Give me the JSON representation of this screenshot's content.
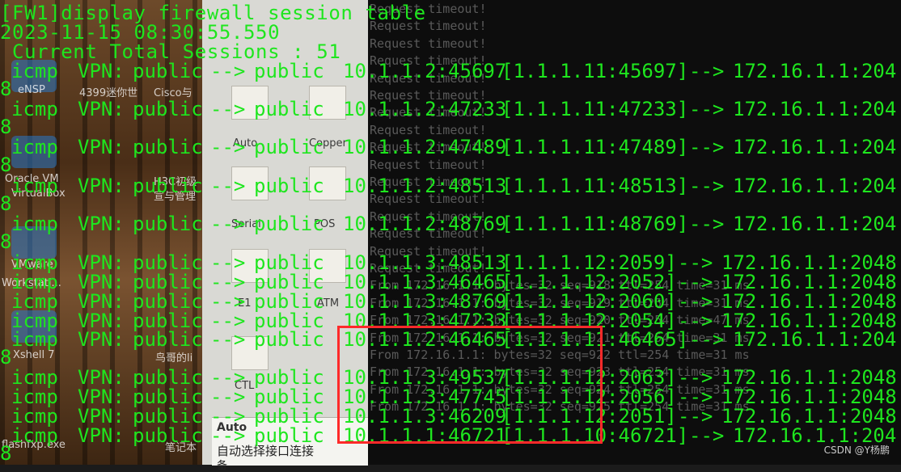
{
  "console": {
    "command": "[FW1]display firewall session table",
    "timestamp": "2023-11-15 08:30:55.550",
    "total": " Current Total Sessions : 51"
  },
  "sessions": [
    {
      "proto": "icmp",
      "vpn": "VPN:",
      "zone": "public",
      "arrow": "-->",
      "to": "public",
      "src": "10.1.1.2:45697",
      "nat": "[1.1.1.11:45697]",
      "arr2": "-->",
      "dst": "172.16.1.1:204",
      "wrap": "8"
    },
    {
      "proto": "icmp",
      "vpn": "VPN:",
      "zone": "public",
      "arrow": "-->",
      "to": "public",
      "src": "10.1.1.2:47233",
      "nat": "[1.1.1.11:47233]",
      "arr2": "-->",
      "dst": "172.16.1.1:204",
      "wrap": "8"
    },
    {
      "proto": "icmp",
      "vpn": "VPN:",
      "zone": "public",
      "arrow": "-->",
      "to": "public",
      "src": "10.1.1.2:47489",
      "nat": "[1.1.1.11:47489]",
      "arr2": "-->",
      "dst": "172.16.1.1:204",
      "wrap": "8"
    },
    {
      "proto": "icmp",
      "vpn": "VPN:",
      "zone": "public",
      "arrow": "-->",
      "to": "public",
      "src": "10.1.1.2:48513",
      "nat": "[1.1.1.11:48513]",
      "arr2": "-->",
      "dst": "172.16.1.1:204",
      "wrap": "8"
    },
    {
      "proto": "icmp",
      "vpn": "VPN:",
      "zone": "public",
      "arrow": "-->",
      "to": "public",
      "src": "10.1.1.2:48769",
      "nat": "[1.1.1.11:48769]",
      "arr2": "-->",
      "dst": "172.16.1.1:204",
      "wrap": "8"
    },
    {
      "proto": "icmp",
      "vpn": "VPN:",
      "zone": "public",
      "arrow": "-->",
      "to": "public",
      "src": "10.1.1.3:48513",
      "nat": "[1.1.1.12:2059]",
      "arr2": "-->",
      "dst": "172.16.1.1:2048",
      "wrap": ""
    },
    {
      "proto": "icmp",
      "vpn": "VPN:",
      "zone": "public",
      "arrow": "-->",
      "to": "public",
      "src": "10.1.1.3:46465",
      "nat": "[1.1.1.12:2052]",
      "arr2": "-->",
      "dst": "172.16.1.1:2048",
      "wrap": ""
    },
    {
      "proto": "icmp",
      "vpn": "VPN:",
      "zone": "public",
      "arrow": "-->",
      "to": "public",
      "src": "10.1.1.3:48769",
      "nat": "[1.1.1.12:2060]",
      "arr2": "-->",
      "dst": "172.16.1.1:2048",
      "wrap": ""
    },
    {
      "proto": "icmp",
      "vpn": "VPN:",
      "zone": "public",
      "arrow": "-->",
      "to": "public",
      "src": "10.1.1.3:47233",
      "nat": "[1.1.1.12:2054]",
      "arr2": "-->",
      "dst": "172.16.1.1:2048",
      "wrap": ""
    },
    {
      "proto": "icmp",
      "vpn": "VPN:",
      "zone": "public",
      "arrow": "-->",
      "to": "public",
      "src": "10.1.1.2:46465",
      "nat": "[1.1.1.11:46465]",
      "arr2": "-->",
      "dst": "172.16.1.1:204",
      "wrap": "8"
    },
    {
      "proto": "icmp",
      "vpn": "VPN:",
      "zone": "public",
      "arrow": "-->",
      "to": "public",
      "src": "10.1.1.3:49537",
      "nat": "[1.1.1.12:2063]",
      "arr2": "-->",
      "dst": "172.16.1.1:2048",
      "wrap": ""
    },
    {
      "proto": "icmp",
      "vpn": "VPN:",
      "zone": "public",
      "arrow": "-->",
      "to": "public",
      "src": "10.1.1.3:47745",
      "nat": "[1.1.1.12:2056]",
      "arr2": "-->",
      "dst": "172.16.1.1:2048",
      "wrap": ""
    },
    {
      "proto": "icmp",
      "vpn": "VPN:",
      "zone": "public",
      "arrow": "-->",
      "to": "public",
      "src": "10.1.1.3:46209",
      "nat": "[1.1.1.12:2051]",
      "arr2": "-->",
      "dst": "172.16.1.1:2048",
      "wrap": ""
    },
    {
      "proto": "icmp",
      "vpn": "VPN:",
      "zone": "public",
      "arrow": "-->",
      "to": "public",
      "src": "10.1.1.1:46721",
      "nat": "[1.1.1.10:46721]",
      "arr2": "-->",
      "dst": "172.16.1.1:204",
      "wrap": "8"
    }
  ],
  "ping_window": {
    "lines": [
      "Request timeout!",
      "Request timeout!",
      "Request timeout!",
      "Request timeout!",
      "Request timeout!",
      "Request timeout!",
      "Request timeout!",
      "Request timeout!",
      "Request timeout!",
      "Request timeout!",
      "Request timeout!",
      "Request timeout!",
      "Request timeout!",
      "Request timeout!",
      "Request timeout!",
      "Request timeout!",
      "From 172.16.1.1: bytes=32 seq=918 ttl=254 time=31 ms",
      "From 172.16.1.1: bytes=32 seq=919 ttl=254 time=31 ms",
      "From 172.16.1.1: bytes=32 seq=920 ttl=254 time=47 ms",
      "From 172.16.1.1: bytes=32 seq=921 ttl=254 time=31 ms",
      "From 172.16.1.1: bytes=32 seq=922 ttl=254 time=31 ms",
      "From 172.16.1.1: bytes=32 seq=923 ttl=254 time=31 ms",
      "From 172.16.1.1: bytes=32 seq=924 ttl=254 time=31 ms",
      "From 172.16.1.1: bytes=32 seq=925 ttl=254 time=31 ms"
    ]
  },
  "desktop": {
    "icons": [
      "eNSP",
      "4399迷你世",
      "Cisco与",
      "Oracle VM",
      "VirtualBox",
      "H3C初级",
      "宣与管理",
      "VMware",
      "Workstati...",
      "Xshell 7",
      "鸟哥的li",
      "flashfxp.exe",
      "笔记本"
    ]
  },
  "device_panel": {
    "labels": [
      "Auto",
      "Copper",
      "Serial",
      "POS",
      "E1",
      "ATM",
      "CTL"
    ],
    "auto_title": "Auto",
    "auto_desc": "自动选择接口连接",
    "auto_desc2": "备"
  },
  "watermark": "CSDN @Y杨鹏",
  "colors": {
    "console_text": "#1ee61e",
    "highlight": "#ff2a2a",
    "ping_text": "#5a5a5a"
  }
}
